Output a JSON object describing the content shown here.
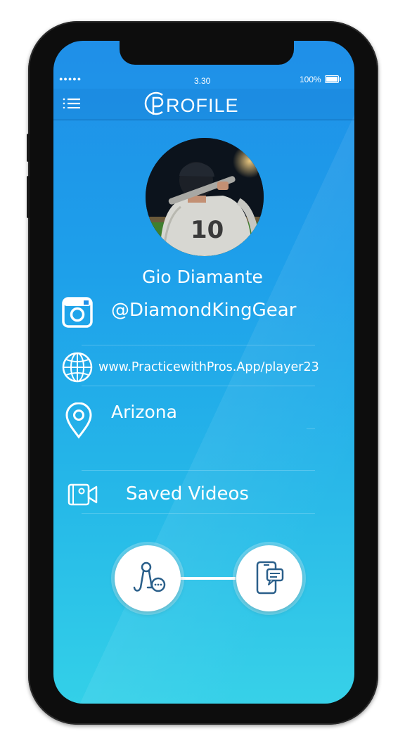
{
  "status_bar": {
    "signal": "●●●●●",
    "time": "3.30",
    "battery": "100%"
  },
  "header": {
    "title": "ROFILE"
  },
  "profile": {
    "name": "Gio Diamante",
    "jersey_number": "10",
    "instagram": "@DiamondKingGear",
    "website": "www.PracticewithPros.App/player23",
    "location": "Arizona",
    "saved_videos": "Saved Videos"
  },
  "colors": {
    "gradient_top": "#1f8fe8",
    "gradient_bottom": "#33d0e8",
    "accent_icon": "#2a5f8a"
  },
  "icons": {
    "menu": "menu-icon",
    "instagram": "instagram-icon",
    "website": "globe-icon",
    "location": "map-pin-icon",
    "videos": "video-camera-icon",
    "coach_chat": "coach-chat-icon",
    "phone_message": "phone-message-icon"
  }
}
